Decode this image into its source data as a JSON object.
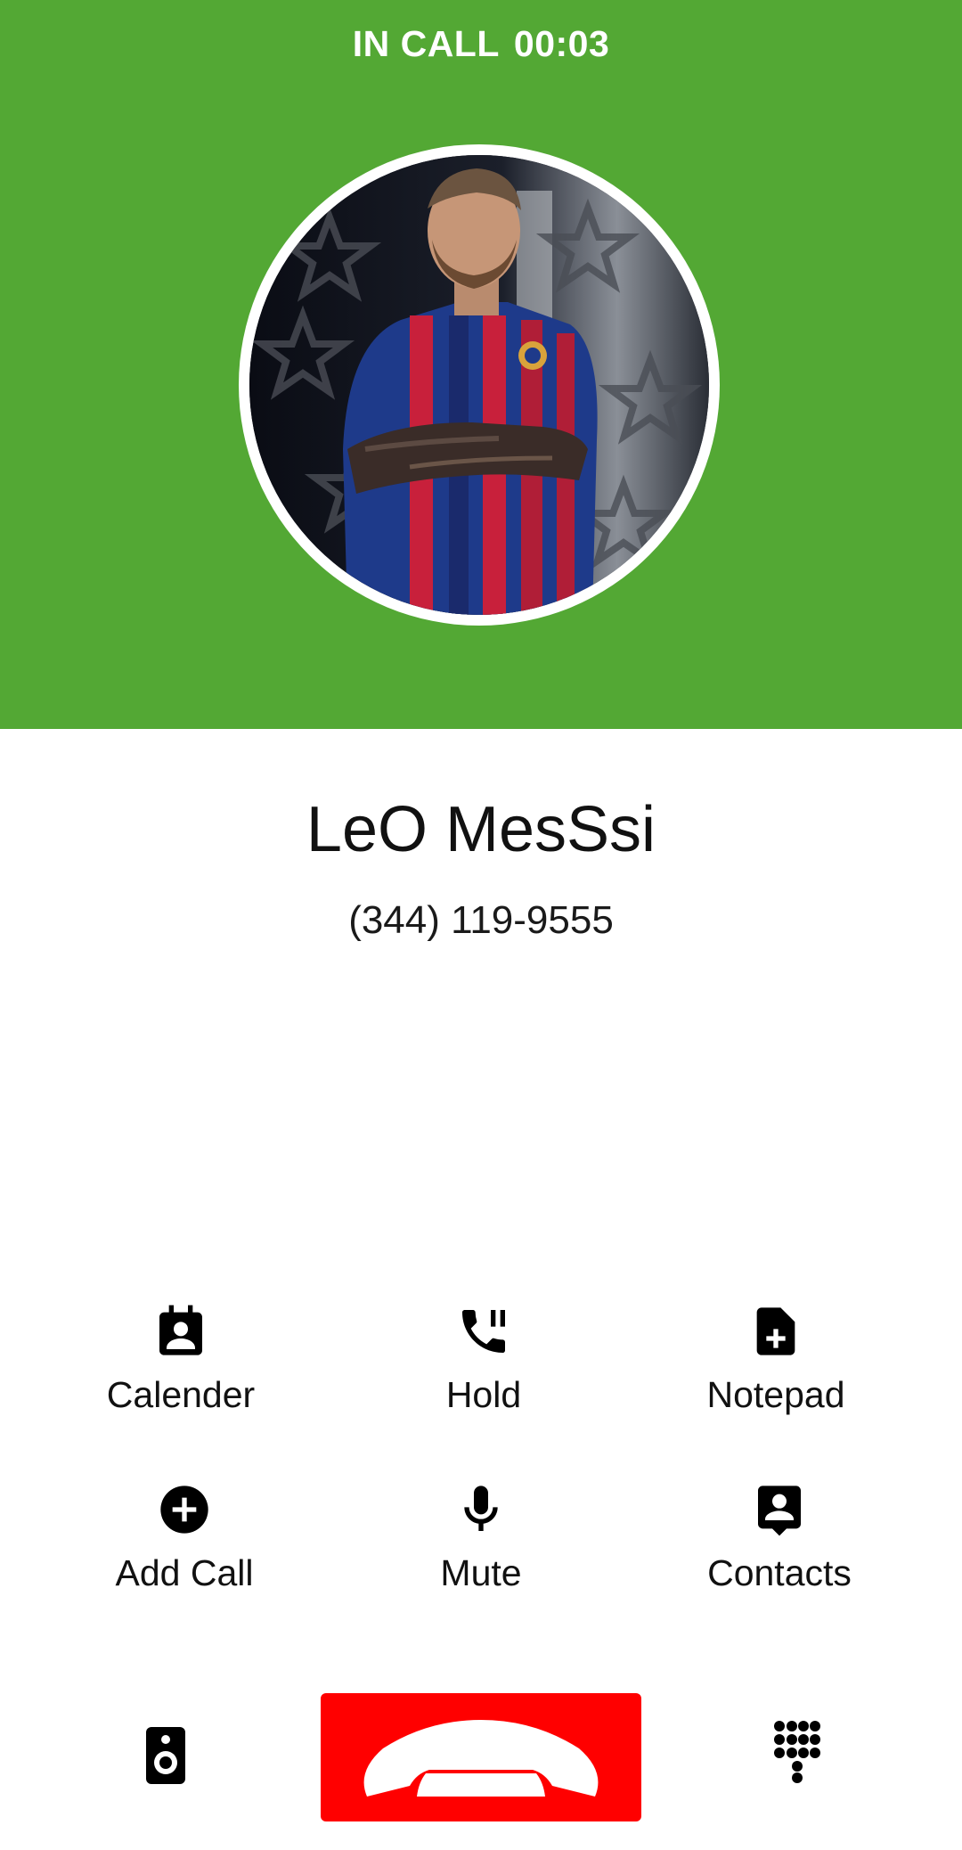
{
  "status": {
    "label": "IN CALL",
    "timer": "00:03"
  },
  "contact": {
    "name": "LeO MesSsi",
    "number": "(344) 119-9555"
  },
  "actions": [
    {
      "label": "Calender",
      "icon": "calendar-contact-icon"
    },
    {
      "label": "Hold",
      "icon": "phone-pause-icon"
    },
    {
      "label": "Notepad",
      "icon": "note-add-icon"
    },
    {
      "label": "Add Call",
      "icon": "add-circle-icon"
    },
    {
      "label": "Mute",
      "icon": "microphone-icon"
    },
    {
      "label": "Contacts",
      "icon": "contact-card-icon"
    }
  ],
  "bottom_bar": {
    "speaker_icon": "speaker-icon",
    "end_call_icon": "end-call-icon",
    "dialpad_icon": "dialpad-icon"
  },
  "colors": {
    "header_green": "#53a834",
    "end_call_red": "#ff0000",
    "icon_black": "#000000"
  }
}
